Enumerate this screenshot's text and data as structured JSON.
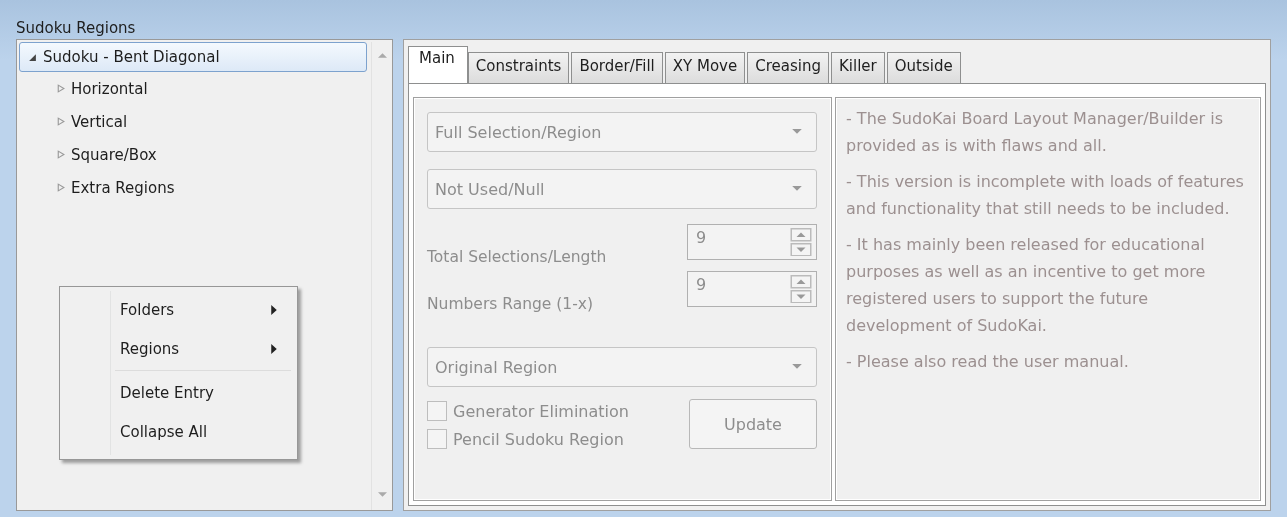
{
  "window": {
    "title": "Sudoku Regions"
  },
  "tree": {
    "items": [
      {
        "label": "Sudoku - Bent Diagonal",
        "expanded": true,
        "selected": true,
        "children": [
          {
            "label": "Horizontal",
            "expanded": false,
            "selected": false
          },
          {
            "label": "Vertical",
            "expanded": false,
            "selected": false
          },
          {
            "label": "Square/Box",
            "expanded": false,
            "selected": false
          },
          {
            "label": "Extra Regions",
            "expanded": false,
            "selected": false
          }
        ]
      }
    ]
  },
  "context_menu": {
    "groups": [
      [
        {
          "label": "Folders",
          "submenu": true
        },
        {
          "label": "Regions",
          "submenu": true
        }
      ],
      [
        {
          "label": "Delete Entry",
          "submenu": false
        },
        {
          "label": "Collapse All",
          "submenu": false
        }
      ]
    ]
  },
  "tabs": [
    {
      "label": "Main",
      "selected": true
    },
    {
      "label": "Constraints",
      "selected": false
    },
    {
      "label": "Border/Fill",
      "selected": false
    },
    {
      "label": "XY Move",
      "selected": false
    },
    {
      "label": "Creasing",
      "selected": false
    },
    {
      "label": "Killer",
      "selected": false
    },
    {
      "label": "Outside",
      "selected": false
    }
  ],
  "form": {
    "disabled": true,
    "dropdowns_top": [
      {
        "value": "Full Selection/Region"
      },
      {
        "value": "Not Used/Null"
      }
    ],
    "spinners": [
      {
        "label": "Total Selections/Length",
        "value": "9"
      },
      {
        "label": "Numbers Range (1-x)",
        "value": "9"
      }
    ],
    "dropdown_bottom": {
      "value": "Original Region"
    },
    "checkboxes": [
      {
        "label": "Generator Elimination",
        "checked": false
      },
      {
        "label": "Pencil Sudoku Region",
        "checked": false
      }
    ],
    "button": "Update"
  },
  "notes": [
    "- The SudoKai Board Layout Manager/Builder is provided as is with flaws and all.",
    "- This version is incomplete with loads of features and functionality that still needs to be included.",
    "- It has mainly been released for educational purposes as well as an incentive to get more registered users to support the future development of SudoKai.",
    "- Please also read the user manual."
  ]
}
